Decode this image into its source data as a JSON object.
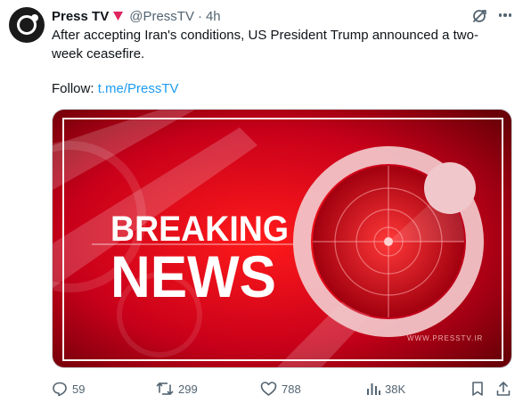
{
  "tweet": {
    "display_name": "Press TV",
    "handle": "@PressTV",
    "separator": "·",
    "time": "4h",
    "text": "After accepting Iran's conditions, US President Trump announced a two-week ceasefire.",
    "follow_prefix": "Follow: ",
    "follow_link": "t.me/PressTV"
  },
  "media": {
    "headline_line1": "BREAKING",
    "headline_line2": "NEWS",
    "watermark": "WWW.PRESSTV.IR"
  },
  "actions": {
    "replies": "59",
    "reposts": "299",
    "likes": "788",
    "views": "38K"
  },
  "icons": {
    "affiliation": "red-triangle-icon",
    "grok": "grok-icon",
    "more": "more-icon",
    "reply": "reply-icon",
    "repost": "repost-icon",
    "like": "heart-icon",
    "views": "views-icon",
    "bookmark": "bookmark-icon",
    "share": "share-icon"
  },
  "colors": {
    "link": "#1d9bf0",
    "muted": "#536471",
    "text": "#0f1419",
    "brand_red": "#e0142a"
  }
}
